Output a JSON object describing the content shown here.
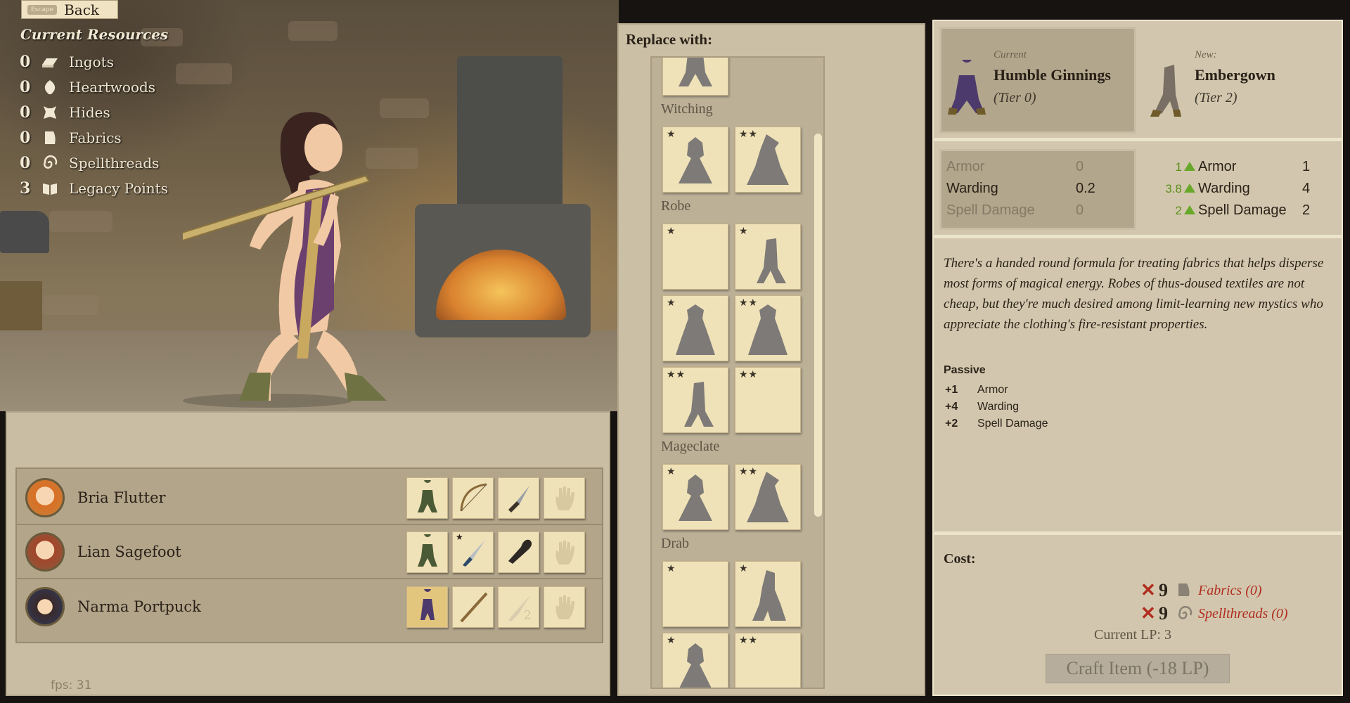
{
  "back_button": {
    "key_label": "Escape",
    "label": "Back"
  },
  "resources": {
    "title": "Current Resources",
    "items": [
      {
        "count": "0",
        "label": "Ingots",
        "icon": "ingot-icon"
      },
      {
        "count": "0",
        "label": "Heartwoods",
        "icon": "heartwood-icon"
      },
      {
        "count": "0",
        "label": "Hides",
        "icon": "hide-icon"
      },
      {
        "count": "0",
        "label": "Fabrics",
        "icon": "fabric-icon"
      },
      {
        "count": "0",
        "label": "Spellthreads",
        "icon": "spellthread-icon"
      },
      {
        "count": "3",
        "label": "Legacy Points",
        "icon": "book-icon"
      }
    ]
  },
  "party": [
    {
      "name": "Bria Flutter",
      "slots": [
        "armor-figure-icon",
        "bow-icon",
        "dagger-icon",
        "empty-hand-icon"
      ]
    },
    {
      "name": "Lian Sagefoot",
      "slots": [
        "armor-figure-icon",
        "sword-icon",
        "club-icon",
        "empty-hand-icon"
      ]
    },
    {
      "name": "Narma Portpuck",
      "slots": [
        "robe-figure-icon",
        "staff-icon",
        "locked-sword-icon",
        "empty-hand-icon"
      ]
    }
  ],
  "party_tier_badge": "2",
  "fps": "fps: 31",
  "replace": {
    "title": "Replace with:",
    "categories": [
      "Witching",
      "Robe",
      "Mageclate",
      "Drab"
    ],
    "stars": {
      "one": "★",
      "two": "★★"
    }
  },
  "current_item": {
    "label": "Current",
    "name": "Humble Ginnings",
    "tier": "(Tier 0)"
  },
  "new_item": {
    "label": "New:",
    "name": "Embergown",
    "tier": "(Tier 2)"
  },
  "stats": {
    "current": [
      {
        "label": "Armor",
        "value": "0"
      },
      {
        "label": "Warding",
        "value": "0.2"
      },
      {
        "label": "Spell Damage",
        "value": "0"
      }
    ],
    "new": [
      {
        "gain": "1",
        "label": "Armor",
        "value": "1"
      },
      {
        "gain": "3.8",
        "label": "Warding",
        "value": "4"
      },
      {
        "gain": "2",
        "label": "Spell Damage",
        "value": "2"
      }
    ]
  },
  "description": "There's a handed round formula for treating fabrics that helps disperse most forms of magical energy. Robes of thus-doused textiles are not cheap, but they're much desired among limit-learning new mystics who appreciate the clothing's fire-resistant properties.",
  "passive": {
    "title": "Passive",
    "items": [
      {
        "value": "+1",
        "label": "Armor"
      },
      {
        "value": "+4",
        "label": "Warding"
      },
      {
        "value": "+2",
        "label": "Spell Damage"
      }
    ]
  },
  "cost": {
    "title": "Cost:",
    "items": [
      {
        "mark": "✕",
        "amount": "9",
        "label": "Fabrics (0)"
      },
      {
        "mark": "✕",
        "amount": "9",
        "label": "Spellthreads (0)"
      }
    ],
    "current_lp": "Current LP: 3",
    "craft_button": "Craft Item (-18 LP)"
  },
  "colors": {
    "insufficient": "#b12c1f",
    "gain": "#67a82a",
    "parchment": "#f0e2b8"
  }
}
